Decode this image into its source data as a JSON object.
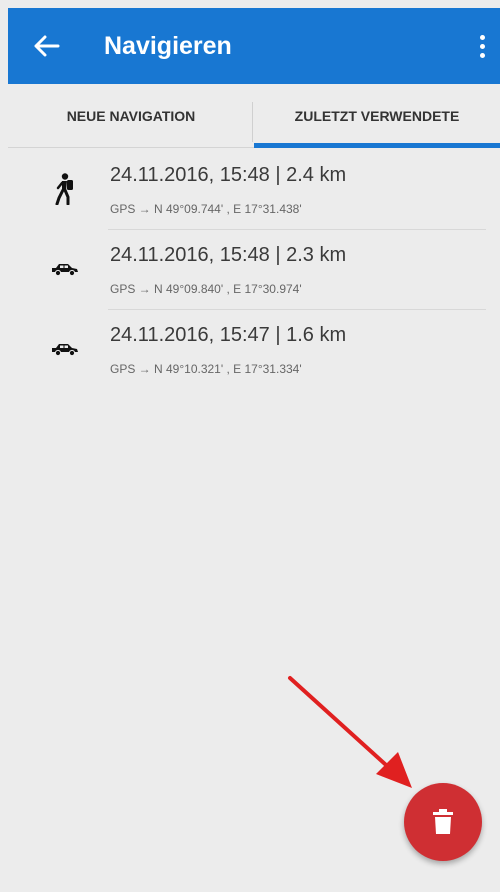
{
  "appbar": {
    "title": "Navigieren",
    "back_icon": "arrow-left-icon",
    "menu_icon": "more-vert-icon",
    "color": "#1877d2"
  },
  "tabs": [
    {
      "label": "NEUE NAVIGATION",
      "active": false
    },
    {
      "label": "ZULETZT VERWENDETE",
      "active": true
    }
  ],
  "items": [
    {
      "icon": "hiking-icon",
      "title": "24.11.2016, 15:48 | 2.4 km",
      "subtitle": "GPS → N 49°09.744' , E 17°31.438'"
    },
    {
      "icon": "car-icon",
      "title": "24.11.2016, 15:48 | 2.3 km",
      "subtitle": "GPS → N 49°09.840' , E 17°30.974'"
    },
    {
      "icon": "car-icon",
      "title": "24.11.2016, 15:47 | 1.6 km",
      "subtitle": "GPS → N 49°10.321' , E 17°31.334'"
    }
  ],
  "fab": {
    "icon": "trash-icon",
    "color": "#cf2f33"
  },
  "annotation": {
    "icon": "red-arrow",
    "color": "#e02020"
  }
}
